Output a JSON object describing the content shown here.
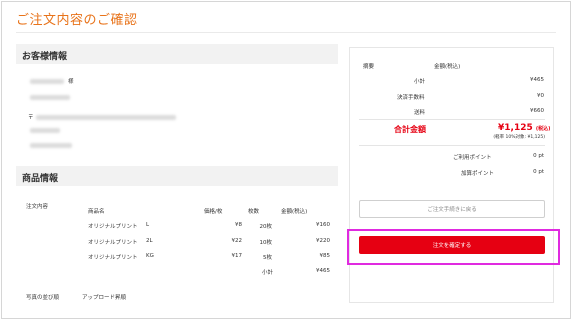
{
  "page_title": "ご注文内容のご確認",
  "customer": {
    "heading": "お客様情報",
    "name_suffix": "様",
    "postal_prefix": "〒"
  },
  "products": {
    "heading": "商品情報",
    "order_label": "注文内容",
    "columns": {
      "name": "商品名",
      "unit_price": "価格/枚",
      "qty": "枚数",
      "amount": "金額(税込)"
    },
    "rows": [
      {
        "name": "オリジナルプリント",
        "size": "L",
        "unit_price": "¥8",
        "qty": "20枚",
        "amount": "¥160"
      },
      {
        "name": "オリジナルプリント",
        "size": "2L",
        "unit_price": "¥22",
        "qty": "10枚",
        "amount": "¥220"
      },
      {
        "name": "オリジナルプリント",
        "size": "KG",
        "unit_price": "¥17",
        "qty": "5枚",
        "amount": "¥85"
      }
    ],
    "subtotal_label": "小計",
    "subtotal_value": "¥465",
    "photo_order_label": "写真の並び順",
    "photo_order_value": "アップロード昇順"
  },
  "summary": {
    "col_item": "摘要",
    "col_amount": "金額(税込)",
    "lines": [
      {
        "label": "小計",
        "value": "¥465"
      },
      {
        "label": "決済手数料",
        "value": "¥0"
      },
      {
        "label": "送料",
        "value": "¥660"
      }
    ],
    "total_label": "合計金額",
    "total_value": "¥1,125",
    "total_suffix": "(税込)",
    "tax_note": "(軽率 10%対象: ¥1,125)",
    "points": [
      {
        "label": "ご利用ポイント",
        "value": "0 pt"
      },
      {
        "label": "加算ポイント",
        "value": "0 pt"
      }
    ],
    "back_button": "ご注文手続きに戻る",
    "confirm_button": "注文を確定する"
  },
  "colors": {
    "accent": "#e8731a",
    "primary_button": "#e60012",
    "highlight": "#e02ae0"
  }
}
